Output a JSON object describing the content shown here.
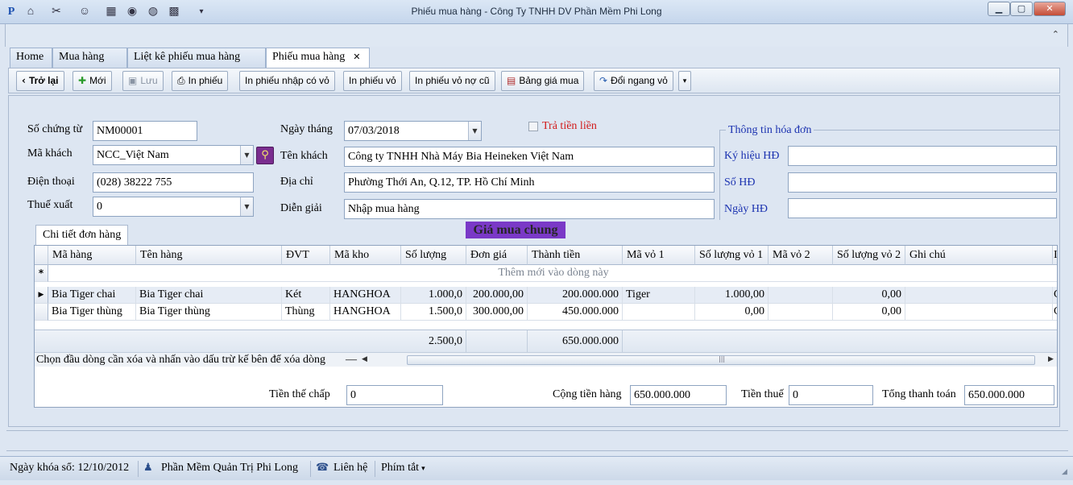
{
  "window": {
    "title": "Phiếu mua hàng - Công Ty TNHH DV Phần Mềm Phi Long",
    "minimize": "▁",
    "maximize": "▢",
    "close": "✕",
    "collapse": "⌃"
  },
  "tabs": [
    {
      "label": "Home"
    },
    {
      "label": "Mua hàng"
    },
    {
      "label": "Liệt kê phiếu mua hàng"
    },
    {
      "label": "Phiếu mua hàng",
      "close": "✕"
    }
  ],
  "toolbar": {
    "back": "Trở lại",
    "new": "Mới",
    "save": "Lưu",
    "print": "In phiếu",
    "print_import_shell": "In phiếu nhập có vỏ",
    "print_shell": "In phiếu vỏ",
    "print_shell_old_debt": "In phiếu vỏ nợ cũ",
    "price_table": "Bảng giá mua",
    "exchange_shell": "Đổi ngang vỏ"
  },
  "form": {
    "doc_no_label": "Số chứng từ",
    "doc_no": "NM00001",
    "customer_code_label": "Mã khách",
    "customer_code": "NCC_Việt Nam",
    "phone_label": "Điện thoại",
    "phone": "(028) 38222 755",
    "tax_rate_label": "Thuế xuất",
    "tax_rate": "0",
    "date_label": "Ngày tháng",
    "date": "07/03/2018",
    "customer_name_label": "Tên khách",
    "customer_name": "Công ty TNHH Nhà Máy Bia Heineken Việt Nam",
    "address_label": "Địa chỉ",
    "address": "Phường Thới An, Q.12, TP. Hồ Chí Minh",
    "description_label": "Diễn giải",
    "description": "Nhập mua hàng",
    "pay_now_label": "Trả tiền liền"
  },
  "invoice": {
    "group_title": "Thông tin hóa đơn",
    "symbol_label": "Ký hiệu HĐ",
    "symbol": "",
    "number_label": "Số HĐ",
    "number": "",
    "date_label": "Ngày HĐ",
    "date": ""
  },
  "banner": "Giá mua chung",
  "detail_tab": "Chi tiết đơn hàng",
  "grid": {
    "columns": [
      "Mã hàng",
      "Tên hàng",
      "ĐVT",
      "Mã kho",
      "Số lượng",
      "Đơn giá",
      "Thành tiền",
      "Mã vỏ 1",
      "Số lượng vỏ 1",
      "Mã vỏ 2",
      "Số lượng vỏ 2",
      "Ghi chú",
      "I"
    ],
    "new_row_text": "Thêm mới vào dòng này",
    "rows": [
      [
        "Bia Tiger chai",
        "Bia Tiger chai",
        "Két",
        "HANGHOA",
        "1.000,0",
        "200.000,00",
        "200.000.000",
        "Tiger",
        "1.000,00",
        "",
        "0,00",
        "",
        "C"
      ],
      [
        "Bia Tiger thùng",
        "Bia Tiger thùng",
        "Thùng",
        "HANGHOA",
        "1.500,0",
        "300.000,00",
        "450.000.000",
        "",
        "0,00",
        "",
        "0,00",
        "",
        "C"
      ]
    ],
    "total_quantity": "2.500,0",
    "total_amount": "650.000.000",
    "delete_hint": "Chọn đầu dòng cần xóa và nhấn vào dấu trừ kế bên để xóa dòng"
  },
  "totals": {
    "deposit_label": "Tiền thế chấp",
    "deposit": "0",
    "goods_total_label": "Cộng tiền hàng",
    "goods_total": "650.000.000",
    "tax_label": "Tiền thuế",
    "tax": "0",
    "grand_total_label": "Tổng thanh toán",
    "grand_total": "650.000.000"
  },
  "statusbar": {
    "lock_date": "Ngày khóa sổ: 12/10/2012",
    "software": "Phần Mềm Quản Trị Phi Long",
    "contact": "Liên hệ",
    "shortcuts": "Phím tắt"
  }
}
